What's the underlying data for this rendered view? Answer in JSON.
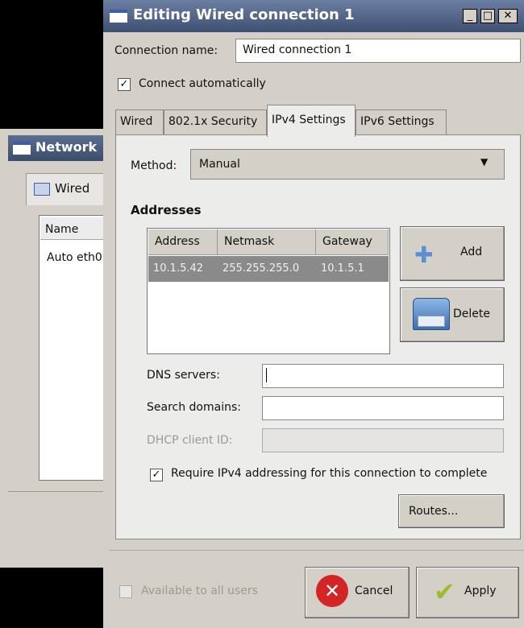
{
  "background_window": {
    "title": "Network",
    "tab_label": "Wired",
    "column_header": "Name",
    "rows": [
      "Auto eth0"
    ]
  },
  "dialog": {
    "title": "Editing Wired connection 1",
    "connection_name_label": "Connection name:",
    "connection_name_value": "Wired connection 1",
    "connect_automatically_label": "Connect automatically",
    "connect_automatically_checked": true,
    "tabs": [
      "Wired",
      "802.1x Security",
      "IPv4 Settings",
      "IPv6 Settings"
    ],
    "active_tab": "IPv4 Settings"
  },
  "ipv4": {
    "method_label": "Method:",
    "method_value": "Manual",
    "addresses_heading": "Addresses",
    "columns": [
      "Address",
      "Netmask",
      "Gateway"
    ],
    "rows": [
      {
        "address": "10.1.5.42",
        "netmask": "255.255.255.0",
        "gateway": "10.1.5.1"
      }
    ],
    "add_label": "Add",
    "delete_label": "Delete",
    "dns_label": "DNS servers:",
    "dns_value": "",
    "search_domains_label": "Search domains:",
    "search_domains_value": "",
    "dhcp_client_id_label": "DHCP client ID:",
    "dhcp_client_id_value": "",
    "require_ipv4_label": "Require IPv4 addressing for this connection to complete",
    "require_ipv4_checked": true,
    "routes_label": "Routes..."
  },
  "footer": {
    "available_all_users_label": "Available to all users",
    "available_all_users_checked": false,
    "cancel_label": "Cancel",
    "apply_label": "Apply"
  },
  "colors": {
    "titlebar": "#4a5b7d",
    "dialog_bg": "#d4d0c8",
    "selected_row": "#8a8a8a",
    "cancel_icon": "#d32525",
    "apply_icon": "#9bbd2a",
    "add_icon": "#5b8fd1"
  }
}
